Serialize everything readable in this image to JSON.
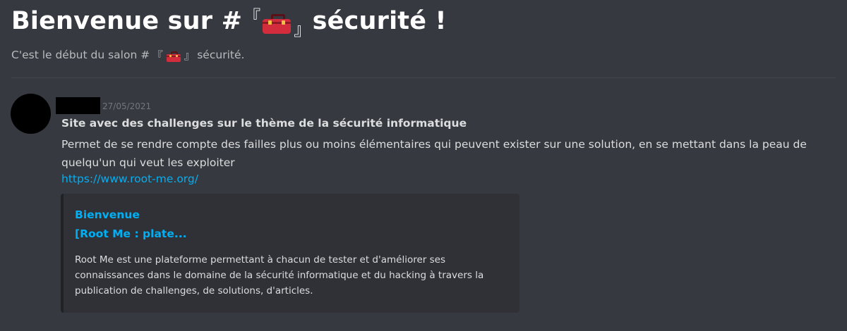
{
  "welcome": {
    "title_prefix": "Bienvenue sur #",
    "bracket_open": "『",
    "bracket_close": "』",
    "channel_name": "sécurité !",
    "channel_icon": "toolbox-icon",
    "sub_prefix": "C'est le début du salon #",
    "sub_bracket_open": "『",
    "sub_bracket_close": "』",
    "sub_channel": "sécurité."
  },
  "message": {
    "timestamp": "27/05/2021",
    "title": "Site avec des challenges sur le thème de la sécurité informatique",
    "body": "Permet de se rendre compte des failles plus ou moins élémentaires qui peuvent exister sur une solution, en se mettant dans la peau de quelqu'un qui veut les exploiter",
    "link": "https://www.root-me.org/"
  },
  "embed": {
    "site_name": "Bienvenue",
    "title": "[Root Me : plate...",
    "description": "Root Me est une plateforme permettant à chacun de tester et d'améliorer ses connaissances dans le domaine de la sécurité informatique et du hacking à travers la publication de challenges, de solutions, d'articles."
  },
  "colors": {
    "background": "#36393f",
    "link": "#00aff4",
    "embed_background": "#2f3136"
  }
}
